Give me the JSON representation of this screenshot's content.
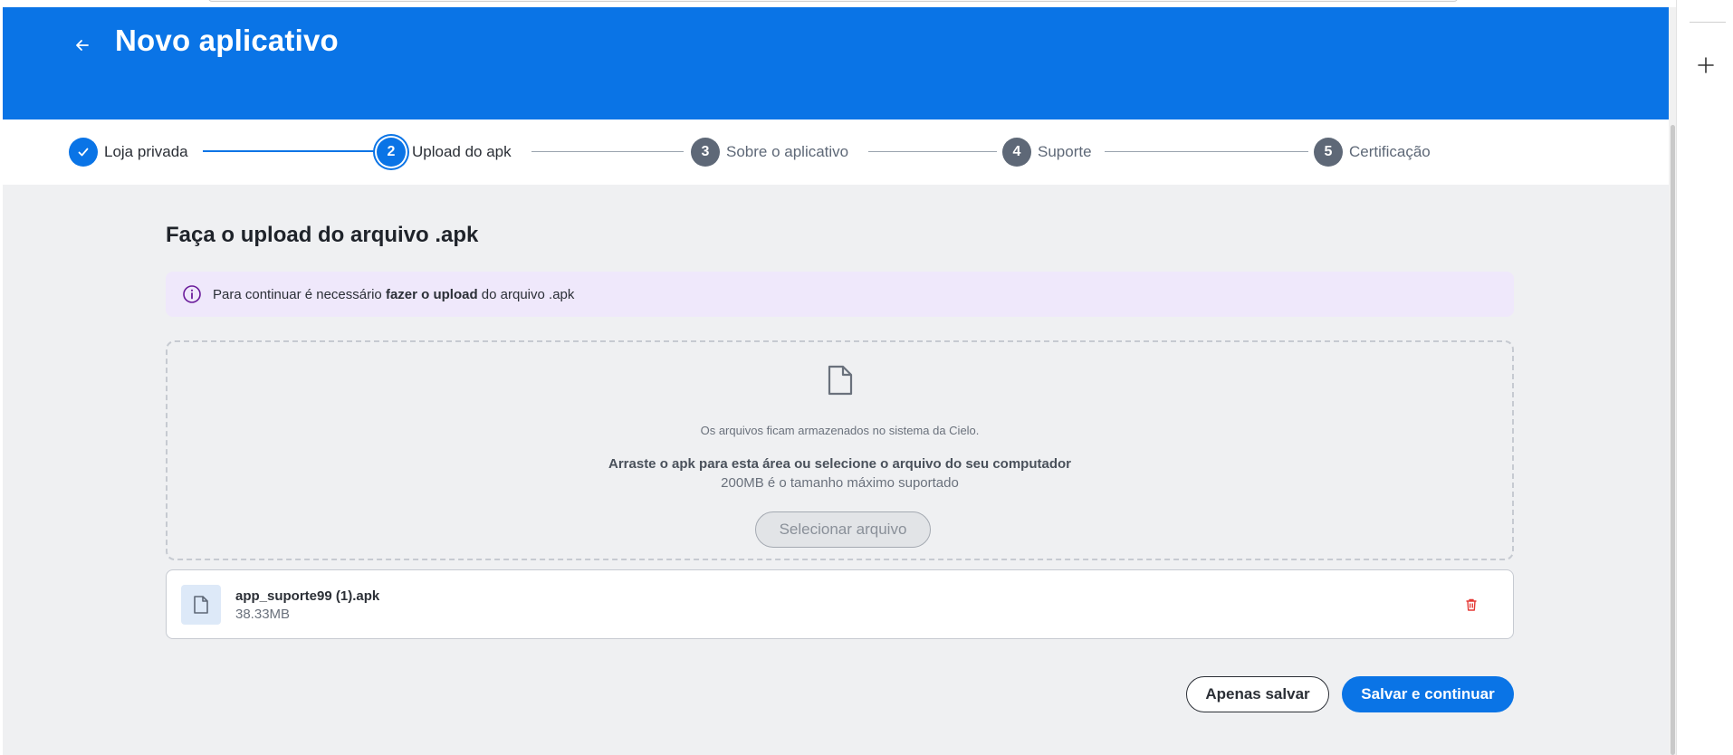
{
  "header": {
    "title": "Novo aplicativo",
    "back_icon": "arrow-left-icon"
  },
  "stepper": {
    "steps": [
      {
        "number": "",
        "label": "Loja privada",
        "state": "done"
      },
      {
        "number": "2",
        "label": "Upload do apk",
        "state": "active"
      },
      {
        "number": "3",
        "label": "Sobre o aplicativo",
        "state": "pending"
      },
      {
        "number": "4",
        "label": "Suporte",
        "state": "pending"
      },
      {
        "number": "5",
        "label": "Certificação",
        "state": "pending"
      }
    ]
  },
  "main": {
    "title": "Faça o upload do arquivo .apk",
    "info": {
      "prefix": "Para continuar é necessário ",
      "bold": "fazer o upload",
      "suffix": " do arquivo .apk"
    },
    "dropzone": {
      "note": "Os arquivos ficam armazenados no sistema da Cielo.",
      "instruction": "Arraste o apk para esta área ou selecione o arquivo do seu computador",
      "limit": "200MB é o tamanho máximo suportado",
      "button": "Selecionar arquivo"
    },
    "file": {
      "name": "app_suporte99 (1).apk",
      "size": "38.33MB"
    }
  },
  "actions": {
    "save_only": "Apenas salvar",
    "save_continue": "Salvar e continuar"
  },
  "colors": {
    "primary": "#0a74e6",
    "info_bg": "#efe8fb",
    "info_icon": "#6a1b9a",
    "danger": "#e53935"
  }
}
